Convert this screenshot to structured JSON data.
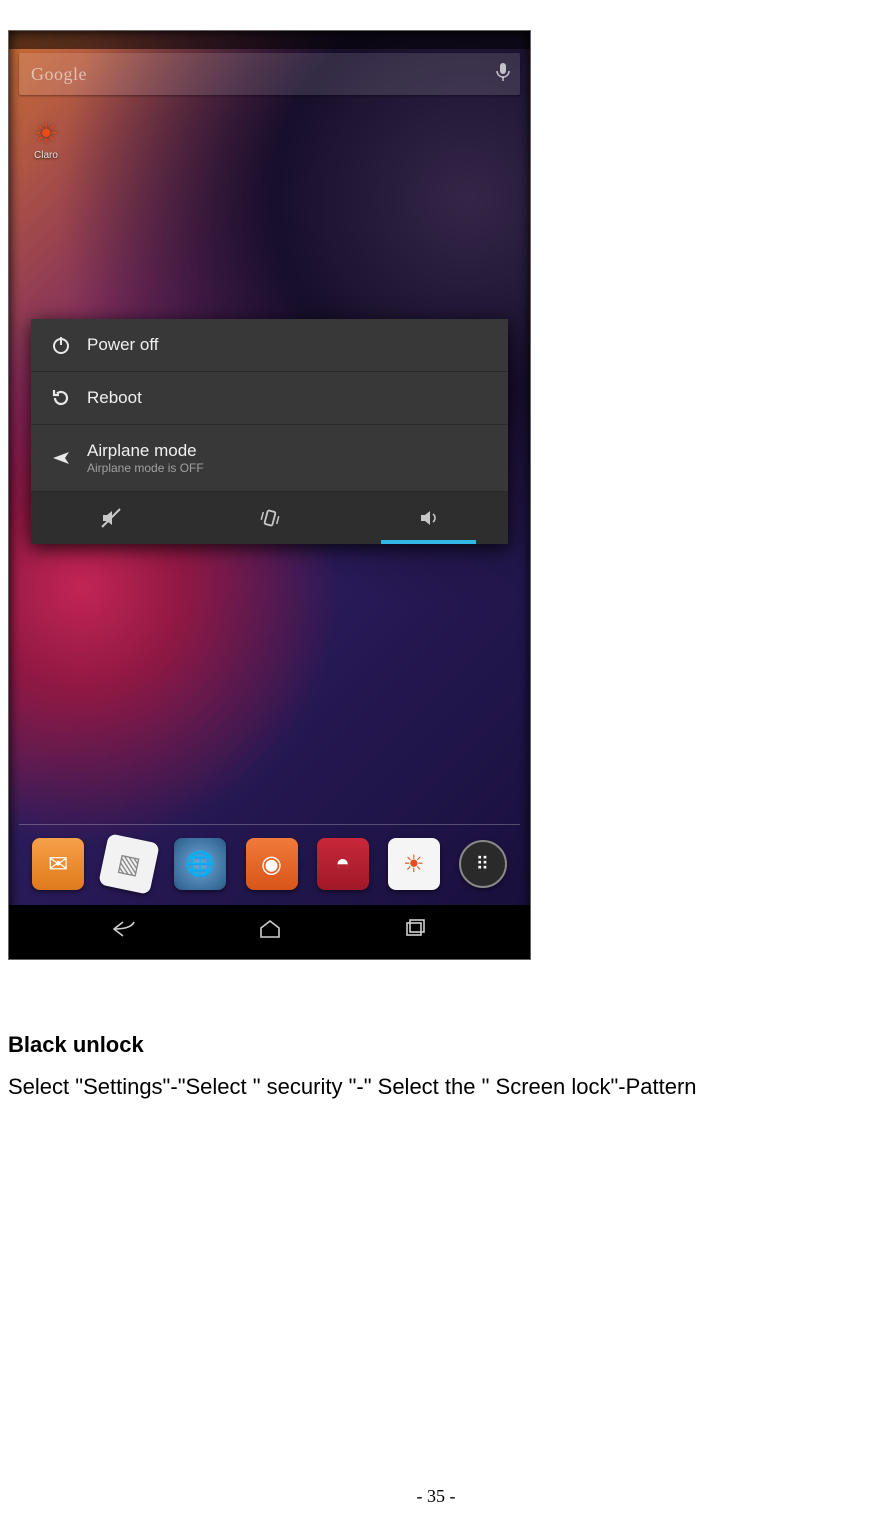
{
  "screenshot": {
    "searchbar": {
      "placeholder": "Google"
    },
    "widget": {
      "label": "Claro"
    },
    "power_menu": {
      "items": [
        {
          "label": "Power off",
          "icon": "power-icon"
        },
        {
          "label": "Reboot",
          "icon": "reboot-icon"
        },
        {
          "label": "Airplane mode",
          "sub": "Airplane mode is OFF",
          "icon": "airplane-icon"
        }
      ],
      "toggles": [
        {
          "name": "silent-toggle",
          "active": false
        },
        {
          "name": "vibrate-toggle",
          "active": false
        },
        {
          "name": "sound-toggle",
          "active": true
        }
      ]
    },
    "dock": [
      {
        "name": "messaging-app-icon"
      },
      {
        "name": "sim-app-icon"
      },
      {
        "name": "browser-app-icon"
      },
      {
        "name": "camera-app-icon"
      },
      {
        "name": "music-app-icon"
      },
      {
        "name": "claro-app-icon"
      },
      {
        "name": "apps-drawer-icon"
      }
    ],
    "navbar": [
      {
        "name": "back-button"
      },
      {
        "name": "home-button"
      },
      {
        "name": "recent-button"
      }
    ]
  },
  "document": {
    "heading": "Black unlock",
    "body": "Select \"Settings\"-\"Select \" security \"-\" Select the \" Screen lock\"-Pattern",
    "page_number": "- 35 -"
  }
}
